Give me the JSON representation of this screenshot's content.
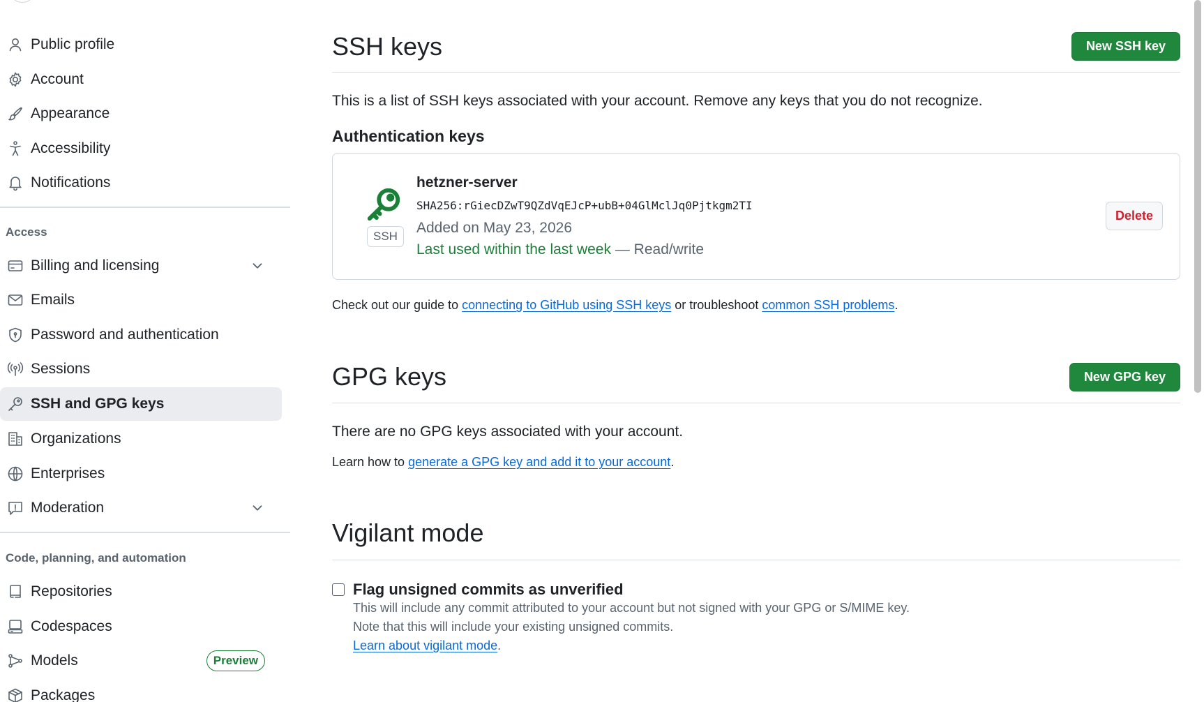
{
  "sidebar": {
    "items": [
      {
        "label": "Public profile",
        "icon": "person-icon"
      },
      {
        "label": "Account",
        "icon": "gear-icon"
      },
      {
        "label": "Appearance",
        "icon": "paintbrush-icon"
      },
      {
        "label": "Accessibility",
        "icon": "accessibility-icon"
      },
      {
        "label": "Notifications",
        "icon": "bell-icon"
      }
    ],
    "access_title": "Access",
    "access_items": [
      {
        "label": "Billing and licensing",
        "icon": "credit-card-icon"
      },
      {
        "label": "Emails",
        "icon": "mail-icon"
      },
      {
        "label": "Password and authentication",
        "icon": "shield-icon"
      },
      {
        "label": "Sessions",
        "icon": "broadcast-icon"
      },
      {
        "label": "SSH and GPG keys",
        "icon": "key-icon",
        "active": true
      },
      {
        "label": "Organizations",
        "icon": "organization-icon"
      },
      {
        "label": "Enterprises",
        "icon": "globe-icon"
      },
      {
        "label": "Moderation",
        "icon": "report-icon"
      }
    ],
    "code_title": "Code, planning, and automation",
    "code_items": [
      {
        "label": "Repositories",
        "icon": "repo-icon"
      },
      {
        "label": "Codespaces",
        "icon": "codespaces-icon"
      },
      {
        "label": "Models",
        "icon": "models-icon",
        "badge": "Preview"
      },
      {
        "label": "Packages",
        "icon": "package-icon"
      }
    ]
  },
  "ssh": {
    "title": "SSH keys",
    "new_button": "New SSH key",
    "description": "This is a list of SSH keys associated with your account. Remove any keys that you do not recognize.",
    "auth_title": "Authentication keys",
    "key": {
      "name": "hetzner-server",
      "fingerprint": "SHA256:rGiecDZwT9QZdVqEJcP+ubB+04GlMclJq0Pjtkgm2TI",
      "added": "Added on May 23, 2026",
      "last_used": "Last used within the last week",
      "access": " — Read/write",
      "type_label": "SSH",
      "delete_label": "Delete"
    },
    "guide_prefix": "Check out our guide to ",
    "guide_link1": "connecting to GitHub using SSH keys",
    "guide_middle": " or troubleshoot ",
    "guide_link2": "common SSH problems",
    "guide_suffix": "."
  },
  "gpg": {
    "title": "GPG keys",
    "new_button": "New GPG key",
    "empty": "There are no GPG keys associated with your account.",
    "learn_prefix": "Learn how to ",
    "learn_link": "generate a GPG key and add it to your account",
    "learn_suffix": "."
  },
  "vigilant": {
    "title": "Vigilant mode",
    "checkbox_label": "Flag unsigned commits as unverified",
    "note1": "This will include any commit attributed to your account but not signed with your GPG or S/MIME key.",
    "note2": "Note that this will include your existing unsigned commits.",
    "learn_link": "Learn about vigilant mode",
    "learn_suffix": "."
  },
  "colors": {
    "accent_green": "#1f883d",
    "link_blue": "#0969da",
    "danger_red": "#cf222e"
  }
}
